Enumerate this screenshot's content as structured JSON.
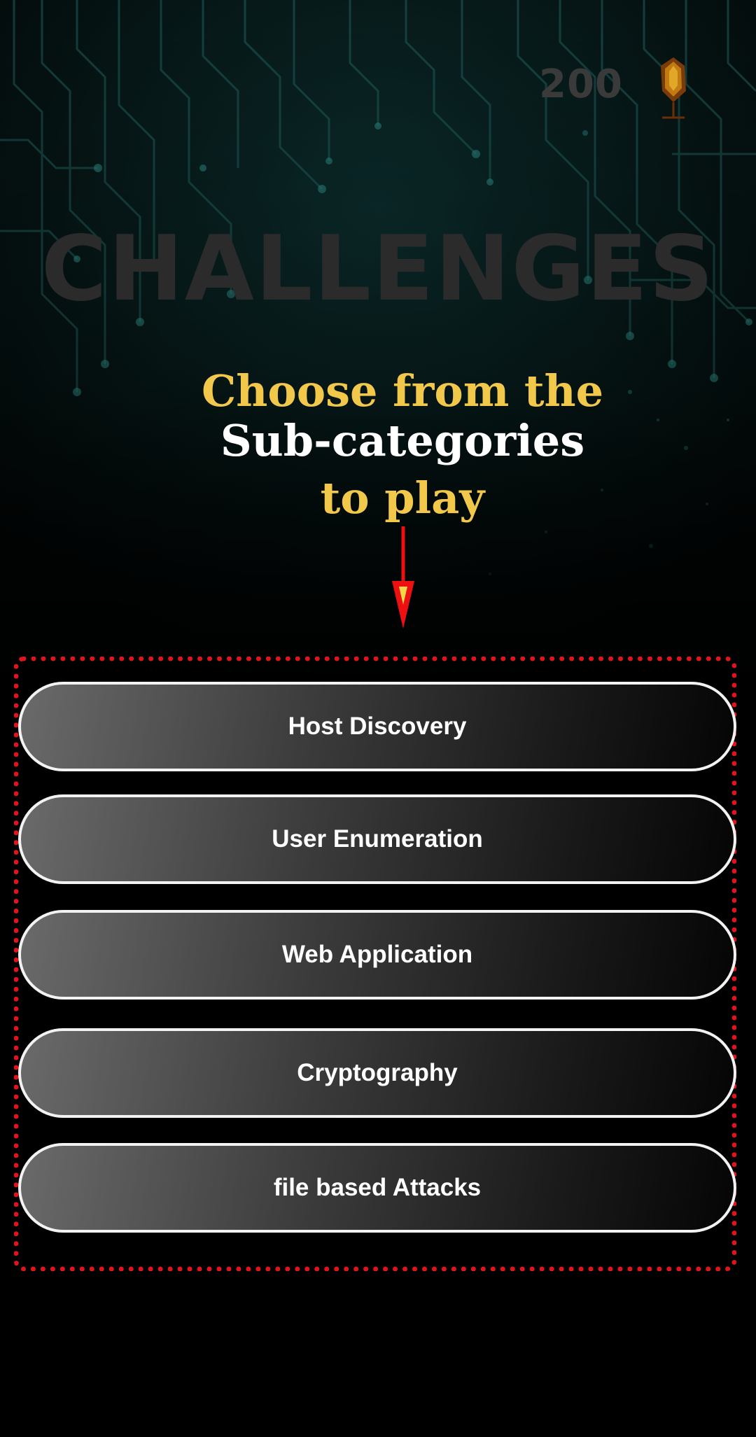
{
  "header": {
    "coin_count": "200",
    "coin_icon": "gem-icon"
  },
  "page_title": "CHALLENGES",
  "instructions": {
    "line1": "Choose from the",
    "line2": "Sub-categories",
    "line3": "to play"
  },
  "subcategories": [
    {
      "label": "Host Discovery"
    },
    {
      "label": "User Enumeration"
    },
    {
      "label": "Web Application"
    },
    {
      "label": "Cryptography"
    },
    {
      "label": "file based Attacks"
    }
  ],
  "colors": {
    "background": "#000000",
    "accent_yellow": "#f2c84b",
    "highlight_red": "#e0141c",
    "circuit_teal": "#1f6b68"
  }
}
